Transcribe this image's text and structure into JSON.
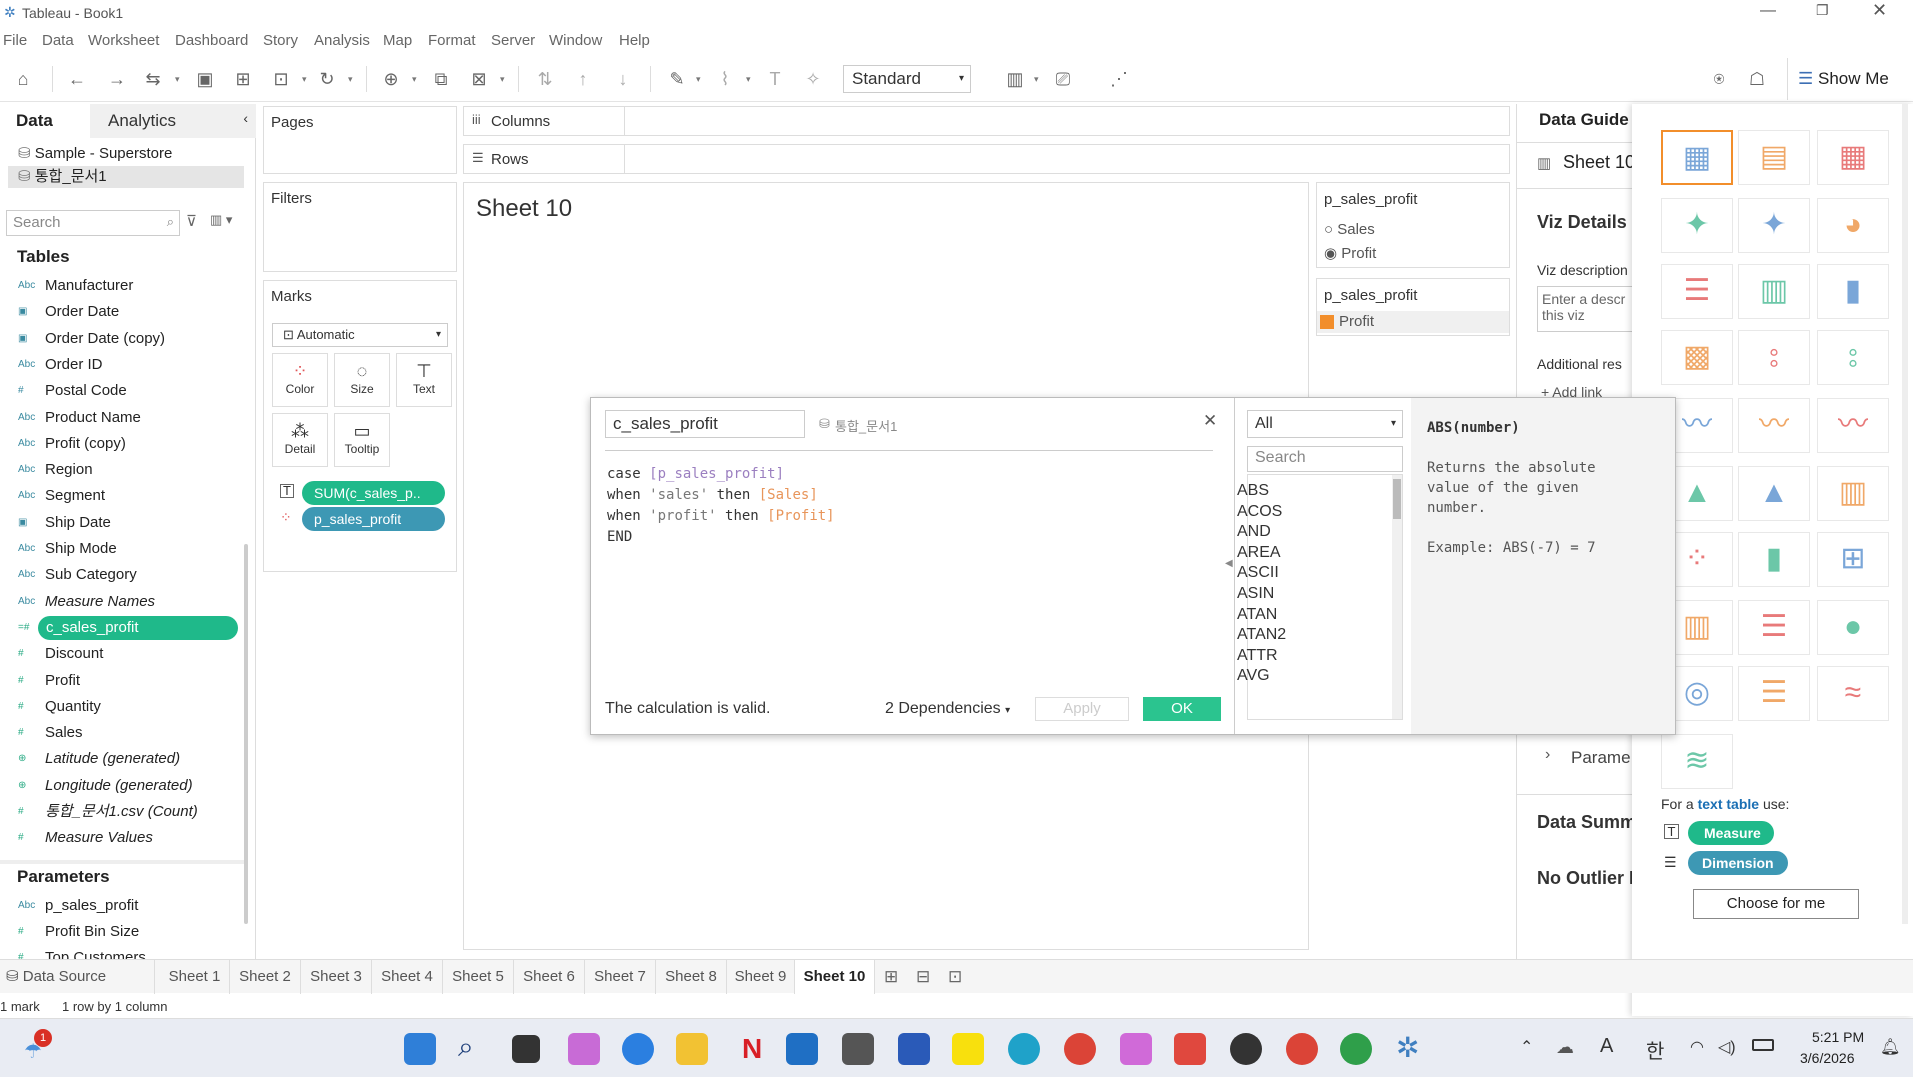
{
  "window": {
    "title": "Tableau - Book1"
  },
  "menu": [
    "File",
    "Data",
    "Worksheet",
    "Dashboard",
    "Story",
    "Analysis",
    "Map",
    "Format",
    "Server",
    "Window",
    "Help"
  ],
  "toolbar": {
    "fit_select": "Standard",
    "show_me": "Show Me"
  },
  "left_panel": {
    "tab_data": "Data",
    "tab_analytics": "Analytics",
    "datasources": [
      "Sample - Superstore",
      "통합_문서1"
    ],
    "search_placeholder": "Search",
    "tables_heading": "Tables",
    "fields": [
      {
        "icon": "Abc",
        "name": "Manufacturer",
        "italic": false,
        "type": "dim"
      },
      {
        "icon": "date",
        "name": "Order Date",
        "italic": false,
        "type": "dim"
      },
      {
        "icon": "date",
        "name": "Order Date (copy)",
        "italic": false,
        "type": "dim"
      },
      {
        "icon": "Abc",
        "name": "Order ID",
        "italic": false,
        "type": "dim"
      },
      {
        "icon": "#",
        "name": "Postal Code",
        "italic": false,
        "type": "dim"
      },
      {
        "icon": "Abc",
        "name": "Product Name",
        "italic": false,
        "type": "dim"
      },
      {
        "icon": "Abc",
        "name": "Profit (copy)",
        "italic": false,
        "type": "dim"
      },
      {
        "icon": "Abc",
        "name": "Region",
        "italic": false,
        "type": "dim"
      },
      {
        "icon": "Abc",
        "name": "Segment",
        "italic": false,
        "type": "dim"
      },
      {
        "icon": "date",
        "name": "Ship Date",
        "italic": false,
        "type": "dim"
      },
      {
        "icon": "Abc",
        "name": "Ship Mode",
        "italic": false,
        "type": "dim"
      },
      {
        "icon": "Abc",
        "name": "Sub Category",
        "italic": false,
        "type": "dim"
      },
      {
        "icon": "Abc",
        "name": "Measure Names",
        "italic": true,
        "type": "dim"
      },
      {
        "icon": "=#",
        "name": "c_sales_profit",
        "italic": false,
        "type": "selected"
      },
      {
        "icon": "#",
        "name": "Discount",
        "italic": false,
        "type": "mea"
      },
      {
        "icon": "#",
        "name": "Profit",
        "italic": false,
        "type": "mea"
      },
      {
        "icon": "#",
        "name": "Quantity",
        "italic": false,
        "type": "mea"
      },
      {
        "icon": "#",
        "name": "Sales",
        "italic": false,
        "type": "mea"
      },
      {
        "icon": "geo",
        "name": "Latitude (generated)",
        "italic": true,
        "type": "mea"
      },
      {
        "icon": "geo",
        "name": "Longitude (generated)",
        "italic": true,
        "type": "mea"
      },
      {
        "icon": "#",
        "name": "통합_문서1.csv (Count)",
        "italic": true,
        "type": "mea"
      },
      {
        "icon": "#",
        "name": "Measure Values",
        "italic": true,
        "type": "mea"
      }
    ],
    "parameters_heading": "Parameters",
    "parameters": [
      {
        "icon": "Abc",
        "name": "p_sales_profit"
      },
      {
        "icon": "#",
        "name": "Profit Bin Size"
      },
      {
        "icon": "#",
        "name": "Top Customers"
      }
    ]
  },
  "shelves": {
    "pages": "Pages",
    "filters": "Filters",
    "columns": "Columns",
    "rows": "Rows",
    "marks": "Marks",
    "mark_type": "Automatic",
    "cards": [
      "Color",
      "Size",
      "Text",
      "Detail",
      "Tooltip"
    ],
    "mark_pills": [
      "SUM(c_sales_p..",
      "p_sales_profit"
    ]
  },
  "view": {
    "sheet_title": "Sheet 10"
  },
  "param_card": {
    "title": "p_sales_profit",
    "options": [
      "Sales",
      "Profit"
    ],
    "selected": "Profit"
  },
  "legend_card": {
    "title": "p_sales_profit",
    "item": "Profit",
    "color": "#f28e2b"
  },
  "calc_dialog": {
    "name": "c_sales_profit",
    "datasource": "통합_문서1",
    "code": [
      [
        "case ",
        "[p_sales_profit]"
      ],
      [
        "when ",
        "'sales'",
        " then ",
        "[Sales]"
      ],
      [
        "when ",
        "'profit'",
        " then ",
        "[Profit]"
      ],
      [
        "END"
      ]
    ],
    "status": "The calculation is valid.",
    "dependencies": "2 Dependencies",
    "apply": "Apply",
    "ok": "OK",
    "category": "All",
    "fn_search_placeholder": "Search",
    "functions": [
      "ABS",
      "ACOS",
      "AND",
      "AREA",
      "ASCII",
      "ASIN",
      "ATAN",
      "ATAN2",
      "ATTR",
      "AVG"
    ],
    "help_title": "ABS(number)",
    "help_desc": "Returns the absolute value of the given number.",
    "help_example": "Example: ABS(-7) = 7"
  },
  "data_guide": {
    "title": "Data Guide",
    "sheet": "Sheet 10",
    "viz_details": "Viz Details",
    "viz_description": "Viz description",
    "enter_placeholder": "Enter a descr this viz",
    "additional": "Additional res",
    "add_link": "Add link",
    "parame": "Parame",
    "data_summ": "Data Summ",
    "no_outlier": "No Outlier M"
  },
  "show_me": {
    "for_text_1": "For a",
    "for_text_link": "text table",
    "for_text_2": "use:",
    "measure": "Measure",
    "dimension": "Dimension",
    "choose": "Choose for me"
  },
  "sheet_tabs": [
    "Data Source",
    "Sheet 1",
    "Sheet 2",
    "Sheet 3",
    "Sheet 4",
    "Sheet 5",
    "Sheet 6",
    "Sheet 7",
    "Sheet 8",
    "Sheet 9",
    "Sheet 10"
  ],
  "status_bar": {
    "marks": "1 mark",
    "rows": "1 row by 1 column"
  },
  "clock": {
    "time": "5:21 PM",
    "date": "3/6/2026"
  },
  "colors": {
    "measure_green": "#1fb98a",
    "dimension_blue": "#3d98b4",
    "accent_orange": "#f28e2b"
  }
}
